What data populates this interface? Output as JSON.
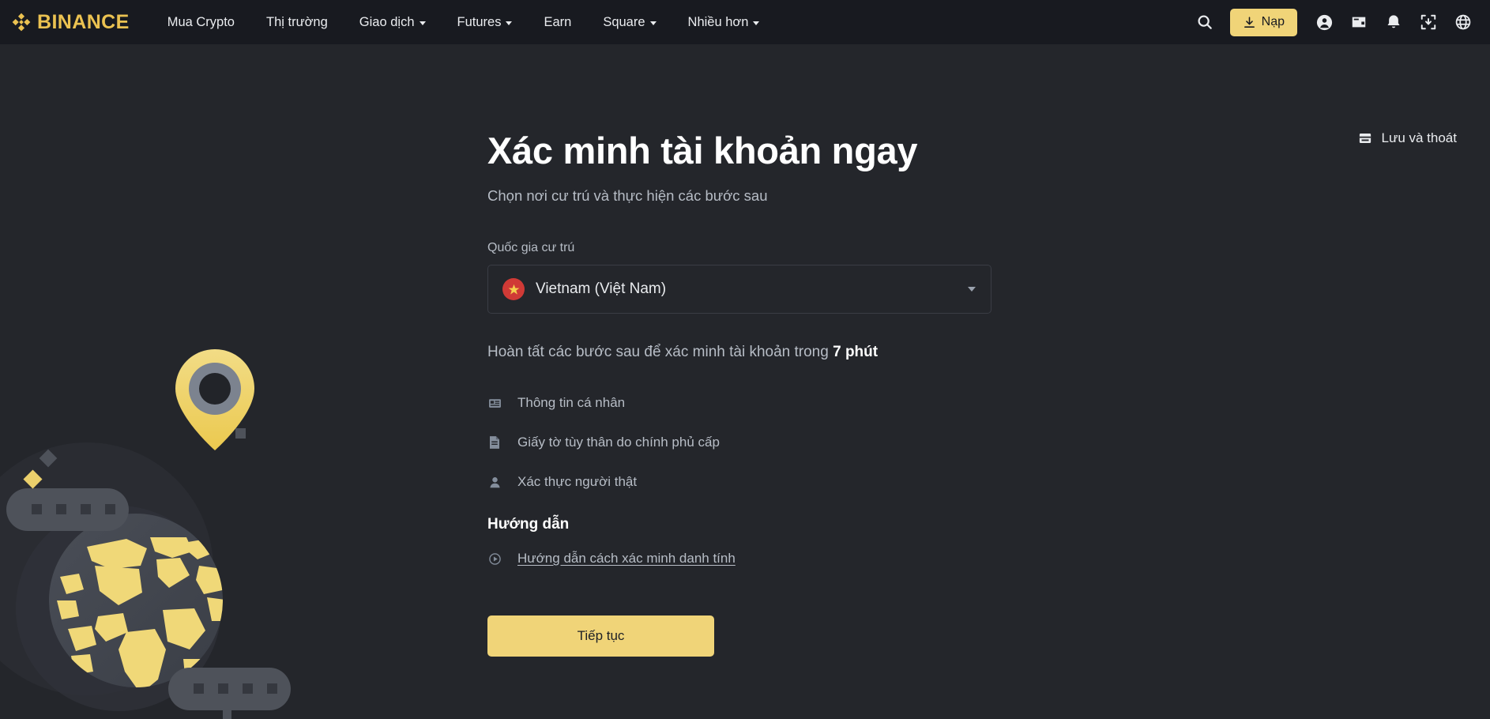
{
  "brand": {
    "name": "BINANCE",
    "logo_color": "#EBC251"
  },
  "header": {
    "nav": [
      {
        "label": "Mua Crypto",
        "caret": false
      },
      {
        "label": "Thị trường",
        "caret": false
      },
      {
        "label": "Giao dịch",
        "caret": true
      },
      {
        "label": "Futures",
        "caret": true
      },
      {
        "label": "Earn",
        "caret": false
      },
      {
        "label": "Square",
        "caret": true
      },
      {
        "label": "Nhiều hơn",
        "caret": true
      }
    ],
    "search_icon": "search-icon",
    "deposit_label": "Nạp",
    "deposit_bg": "#F0D478",
    "icons": [
      "user-profile-icon",
      "wallet-icon",
      "notification-bell-icon",
      "download-app-icon",
      "language-globe-icon"
    ]
  },
  "main": {
    "title": "Xác minh tài khoản ngay",
    "subtitle": "Chọn nơi cư trú và thực hiện các bước sau",
    "country": {
      "label": "Quốc gia cư trú",
      "selected": "Vietnam (Việt Nam)",
      "flag_color": "#D03A36",
      "star_color": "#F5D04E"
    },
    "steps_intro_prefix": "Hoàn tất các bước sau để xác minh tài khoản trong ",
    "steps_intro_time": "7 phút",
    "steps": [
      {
        "label": "Thông tin cá nhân",
        "icon": "id-card-icon"
      },
      {
        "label": "Giấy tờ tùy thân do chính phủ cấp",
        "icon": "document-icon"
      },
      {
        "label": "Xác thực người thật",
        "icon": "person-icon"
      }
    ],
    "guide_title": "Hướng dẫn",
    "guide_link": "Hướng dẫn cách xác minh danh tính",
    "guide_icon": "play-circle-icon",
    "continue_label": "Tiếp tục"
  },
  "save_exit": {
    "label": "Lưu và thoát",
    "icon": "save-exit-icon"
  },
  "illustration": {
    "name": "globe-location-illustration",
    "globe_land_color": "#F0D878",
    "pin_color": "#F0D05A"
  }
}
